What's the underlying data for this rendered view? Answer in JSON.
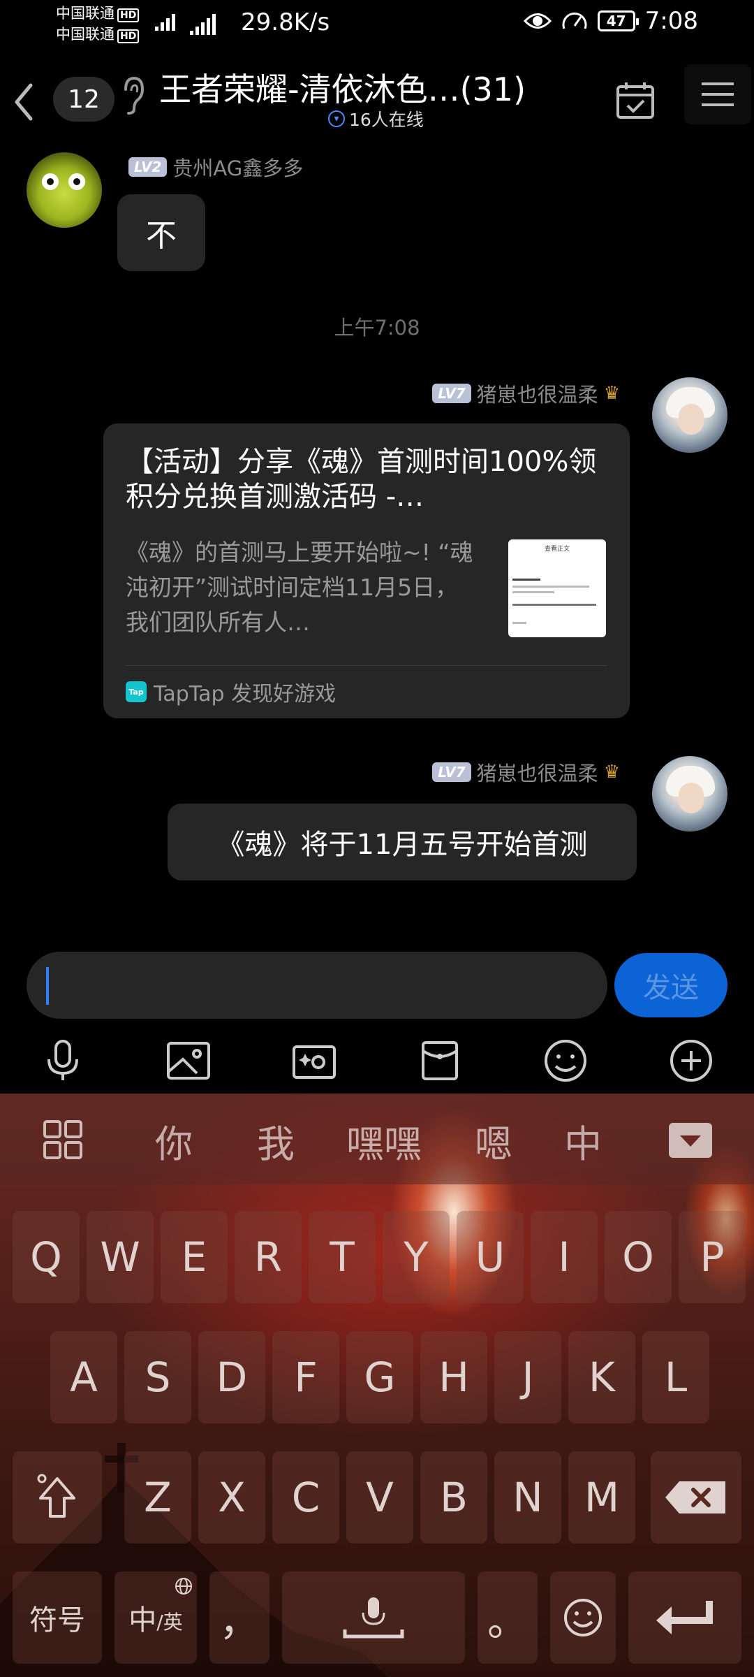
{
  "status_bar": {
    "carrier_1": "中国联通",
    "carrier_2": "中国联通",
    "hd": "HD",
    "net_speed": "29.8K/s",
    "battery": "47",
    "time": "7:08"
  },
  "header": {
    "unread_count": "12",
    "title": "王者荣耀-清依沐色…(31)",
    "online": "16人在线"
  },
  "messages": {
    "m1": {
      "level": "LV2",
      "sender": "贵州AG鑫多多",
      "text": "不"
    },
    "timestamp": "上午7:08",
    "m2": {
      "level": "LV7",
      "sender": "猪崽也很温柔",
      "card_title": "【活动】分享《魂》首测时间100%领积分兑换首测激活码 -…",
      "card_desc": "《魂》的首测马上要开始啦~! “魂沌初开”测试时间定档11月5日，我们团队所有人…",
      "card_source": "TapTap 发现好游戏",
      "thumb_heading": "查看正文",
      "tap_badge": "Tap"
    },
    "m3": {
      "level": "LV7",
      "sender": "猪崽也很温柔",
      "text": "《魂》将于11月五号开始首测"
    }
  },
  "input": {
    "value": "",
    "send_label": "发送"
  },
  "keyboard": {
    "candidates": [
      "你",
      "我",
      "嘿嘿",
      "嗯",
      "中"
    ],
    "row1": [
      "Q",
      "W",
      "E",
      "R",
      "T",
      "Y",
      "U",
      "I",
      "O",
      "P"
    ],
    "row2": [
      "A",
      "S",
      "D",
      "F",
      "G",
      "H",
      "J",
      "K",
      "L"
    ],
    "row3": [
      "Z",
      "X",
      "C",
      "V",
      "B",
      "N",
      "M"
    ],
    "symbols_label": "符号",
    "lang_label_main": "中",
    "lang_label_sub": "/英",
    "comma": "，",
    "period": "。"
  }
}
